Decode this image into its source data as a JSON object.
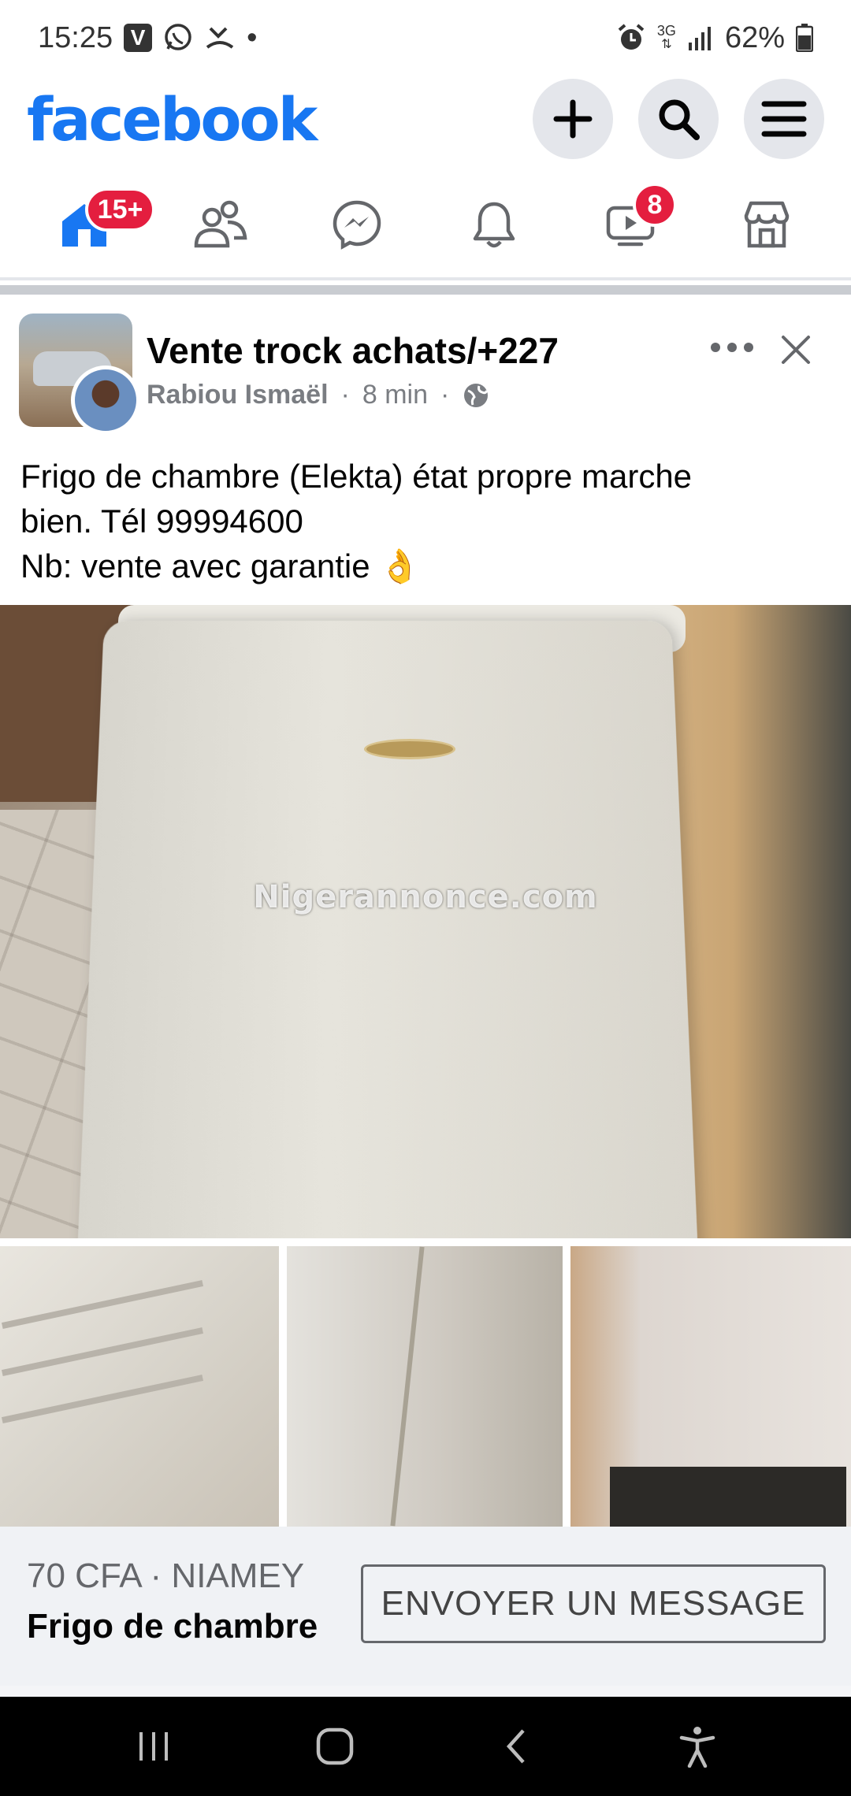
{
  "status_bar": {
    "time": "15:25",
    "v_label": "V",
    "dot": "•",
    "network": "3G",
    "battery": "62%",
    "icons": [
      "v-icon",
      "whatsapp-icon",
      "missed-call-icon",
      "alarm-icon",
      "data-arrows-icon",
      "signal-icon",
      "battery-icon"
    ]
  },
  "header": {
    "logo": "facebook",
    "brand_color": "#1877f2",
    "actions": [
      "plus-icon",
      "search-icon",
      "menu-icon"
    ]
  },
  "nav": {
    "tabs": [
      {
        "name": "home",
        "icon": "home-icon",
        "badge": "15+",
        "active": true
      },
      {
        "name": "friends",
        "icon": "friends-icon"
      },
      {
        "name": "messenger",
        "icon": "messenger-icon"
      },
      {
        "name": "notifications",
        "icon": "bell-icon"
      },
      {
        "name": "video",
        "icon": "video-icon",
        "badge": "8"
      },
      {
        "name": "marketplace",
        "icon": "marketplace-icon"
      }
    ],
    "badge_color": "#e41e3f"
  },
  "post": {
    "group_name": "Vente trock achats/+227",
    "author": "Rabiou Ismaël",
    "time": "8 min",
    "separator": "·",
    "privacy_icon": "globe-icon",
    "text_lines": [
      "Frigo de chambre (Elekta) état propre marche",
      "bien. Tél 99994600",
      "Nb: vente avec garantie 👌"
    ],
    "watermark": "Nigerannonce.com"
  },
  "marketplace": {
    "price_location": "70 CFA · NIAMEY",
    "item_title": "Frigo de chambre",
    "message_button": "ENVOYER UN MESSAGE"
  },
  "android_nav": [
    "recents-icon",
    "home-circle-icon",
    "back-icon",
    "accessibility-icon"
  ]
}
